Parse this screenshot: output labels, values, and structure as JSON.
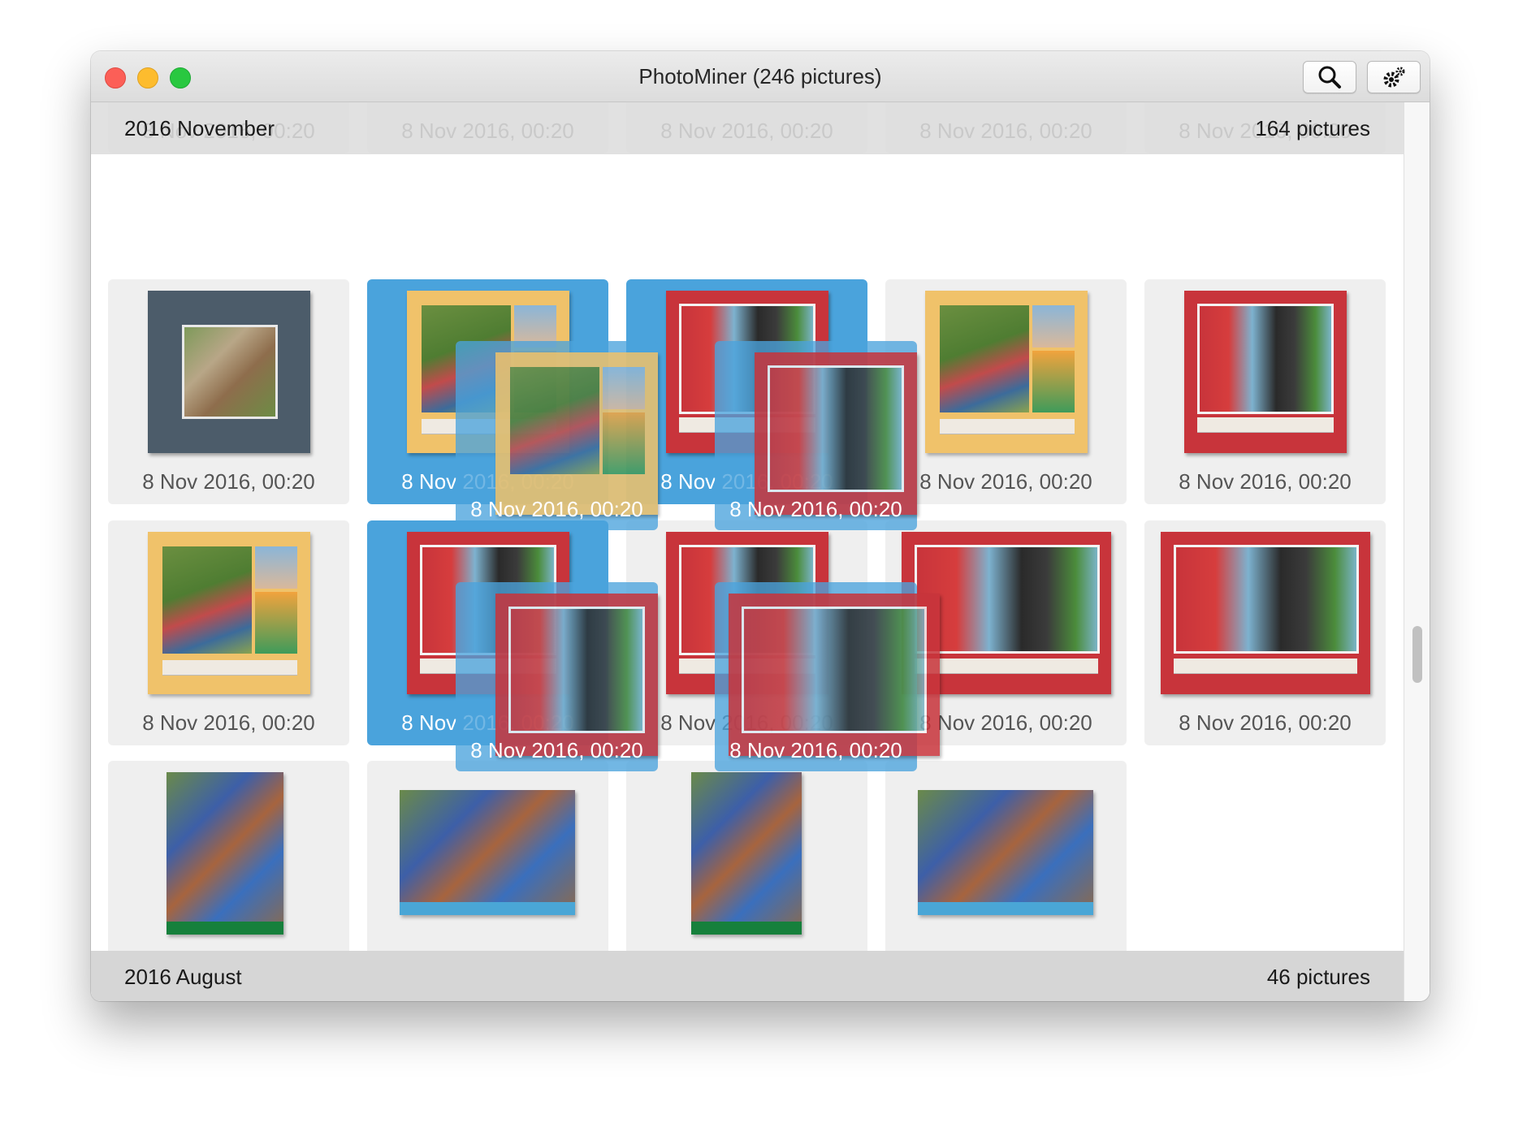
{
  "window": {
    "title": "PhotoMiner (246 pictures)"
  },
  "toolbar": {
    "search_icon": "search-icon",
    "settings_icon": "gear-icon"
  },
  "sections": [
    {
      "label": "2016 November",
      "count": "164 pictures"
    },
    {
      "label": "2016 August",
      "count": "46 pictures"
    }
  ],
  "tiles": {
    "caption": "8 Nov 2016, 00:20"
  },
  "drag": {
    "caption": "8 Nov 2016, 00:20"
  },
  "colors": {
    "selection": "#4aa3dc",
    "tile_bg": "#efefef"
  }
}
